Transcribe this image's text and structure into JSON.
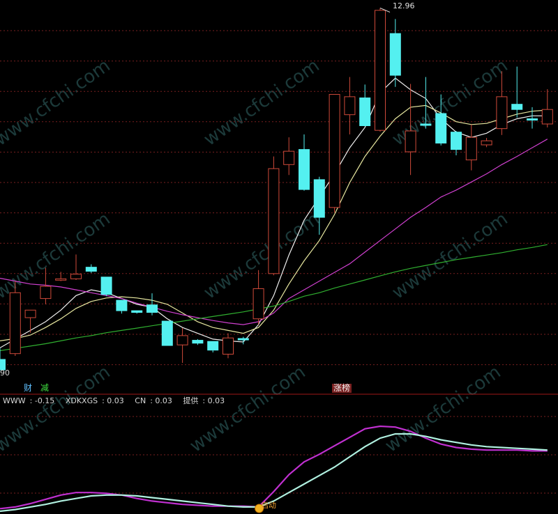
{
  "colors": {
    "background": "#000000",
    "grid": "#7a1f1f",
    "separator": "#a01818",
    "up": "#d04a3a",
    "down": "#54f0f0",
    "ma_white": "#f0f0f0",
    "ma_yellow": "#e8e8a0",
    "ma_magenta": "#d040d0",
    "ma_green": "#30b030",
    "ind_magenta": "#c030d0",
    "ind_cyan": "#b0f0e0",
    "watermark": "#1c3a3a"
  },
  "price_panel": {
    "high_label": "12.96",
    "low_label": "90",
    "tag_cai": "财",
    "tag_jian": "减",
    "tag_zhangbang": "涨榜"
  },
  "indicator_panel": {
    "readout": [
      {
        "name": "WWW",
        "value": "-0.15"
      },
      {
        "name": "XDKXGS",
        "value": "0.03"
      },
      {
        "name": "CN",
        "value": "0.03"
      },
      {
        "name": "提供",
        "value": "0.03"
      }
    ],
    "signal_label": "启动"
  },
  "watermark": "www.cfchi.com",
  "chart_data": [
    {
      "type": "candlestick",
      "ylim": [
        6.6,
        13.05
      ],
      "high_marker": 12.96,
      "candles": [
        {
          "o": 6.9,
          "h": 7.1,
          "l": 6.72,
          "c": 6.72,
          "up": false
        },
        {
          "o": 7.0,
          "h": 8.25,
          "l": 6.96,
          "c": 8.05,
          "up": true
        },
        {
          "o": 7.62,
          "h": 7.75,
          "l": 7.36,
          "c": 7.75,
          "up": true
        },
        {
          "o": 7.95,
          "h": 8.48,
          "l": 7.85,
          "c": 8.16,
          "up": true
        },
        {
          "o": 8.29,
          "h": 8.41,
          "l": 8.25,
          "c": 8.29,
          "up": true
        },
        {
          "o": 8.29,
          "h": 8.71,
          "l": 8.27,
          "c": 8.37,
          "up": true
        },
        {
          "o": 8.49,
          "h": 8.54,
          "l": 8.39,
          "c": 8.42,
          "up": false
        },
        {
          "o": 8.32,
          "h": 8.32,
          "l": 7.99,
          "c": 8.02,
          "up": false
        },
        {
          "o": 7.92,
          "h": 7.92,
          "l": 7.69,
          "c": 7.74,
          "up": false
        },
        {
          "o": 7.74,
          "h": 7.74,
          "l": 7.69,
          "c": 7.71,
          "up": false
        },
        {
          "o": 7.84,
          "h": 8.04,
          "l": 7.66,
          "c": 7.71,
          "up": false
        },
        {
          "o": 7.56,
          "h": 7.56,
          "l": 7.14,
          "c": 7.14,
          "up": false
        },
        {
          "o": 7.15,
          "h": 7.44,
          "l": 6.84,
          "c": 7.31,
          "up": true
        },
        {
          "o": 7.23,
          "h": 7.25,
          "l": 7.15,
          "c": 7.18,
          "up": false
        },
        {
          "o": 7.21,
          "h": 7.21,
          "l": 7.02,
          "c": 7.06,
          "up": false
        },
        {
          "o": 6.99,
          "h": 7.35,
          "l": 6.92,
          "c": 7.27,
          "up": true
        },
        {
          "o": 7.26,
          "h": 7.29,
          "l": 7.16,
          "c": 7.24,
          "up": false
        },
        {
          "o": 7.6,
          "h": 8.44,
          "l": 7.5,
          "c": 8.12,
          "up": true
        },
        {
          "o": 8.38,
          "h": 10.4,
          "l": 8.35,
          "c": 10.19,
          "up": true
        },
        {
          "o": 10.26,
          "h": 10.73,
          "l": 10.08,
          "c": 10.49,
          "up": true
        },
        {
          "o": 10.52,
          "h": 10.78,
          "l": 9.81,
          "c": 9.83,
          "up": false
        },
        {
          "o": 10.0,
          "h": 10.05,
          "l": 9.05,
          "c": 9.35,
          "up": false
        },
        {
          "o": 9.52,
          "h": 11.47,
          "l": 9.43,
          "c": 11.47,
          "up": true
        },
        {
          "o": 11.12,
          "h": 11.77,
          "l": 10.78,
          "c": 11.43,
          "up": true
        },
        {
          "o": 11.41,
          "h": 11.64,
          "l": 10.92,
          "c": 10.93,
          "up": false
        },
        {
          "o": 10.85,
          "h": 12.96,
          "l": 10.83,
          "c": 12.92,
          "up": true
        },
        {
          "o": 12.52,
          "h": 12.77,
          "l": 11.6,
          "c": 11.8,
          "up": false
        },
        {
          "o": 10.48,
          "h": 11.65,
          "l": 10.08,
          "c": 10.84,
          "up": true
        },
        {
          "o": 10.96,
          "h": 11.77,
          "l": 10.88,
          "c": 10.96,
          "up": false
        },
        {
          "o": 11.14,
          "h": 11.47,
          "l": 10.59,
          "c": 10.63,
          "up": false
        },
        {
          "o": 10.82,
          "h": 10.84,
          "l": 10.42,
          "c": 10.52,
          "up": false
        },
        {
          "o": 10.34,
          "h": 10.95,
          "l": 10.16,
          "c": 10.73,
          "up": true
        },
        {
          "o": 10.6,
          "h": 10.72,
          "l": 10.56,
          "c": 10.67,
          "up": true
        },
        {
          "o": 10.88,
          "h": 11.87,
          "l": 10.77,
          "c": 11.43,
          "up": true
        },
        {
          "o": 11.21,
          "h": 11.95,
          "l": 11.07,
          "c": 11.3,
          "up": false
        },
        {
          "o": 11.05,
          "h": 11.25,
          "l": 10.88,
          "c": 11.05,
          "up": false
        },
        {
          "o": 10.96,
          "h": 11.56,
          "l": 10.9,
          "c": 11.21,
          "up": true
        }
      ],
      "series": [
        {
          "color": "ma_white",
          "values": [
            7.1,
            7.25,
            7.4,
            7.55,
            7.75,
            8.0,
            8.1,
            8.05,
            7.95,
            7.85,
            7.8,
            7.6,
            7.45,
            7.35,
            7.25,
            7.22,
            7.2,
            7.5,
            8.0,
            8.7,
            9.3,
            9.7,
            10.1,
            10.55,
            10.9,
            11.5,
            11.75,
            11.55,
            11.4,
            11.05,
            10.82,
            10.73,
            10.8,
            10.95,
            11.05,
            11.1,
            11.1
          ]
        },
        {
          "color": "ma_yellow",
          "values": [
            7.22,
            7.26,
            7.32,
            7.45,
            7.6,
            7.78,
            7.9,
            7.96,
            7.98,
            7.96,
            7.92,
            7.85,
            7.7,
            7.55,
            7.45,
            7.4,
            7.35,
            7.45,
            7.75,
            8.2,
            8.6,
            8.95,
            9.4,
            9.95,
            10.4,
            10.75,
            11.05,
            11.25,
            11.28,
            11.15,
            11.0,
            10.95,
            10.97,
            11.05,
            11.13,
            11.18,
            11.2
          ]
        },
        {
          "color": "ma_magenta",
          "values": [
            8.3,
            8.25,
            8.2,
            8.18,
            8.15,
            8.1,
            8.05,
            8.0,
            7.95,
            7.87,
            7.8,
            7.73,
            7.67,
            7.62,
            7.57,
            7.53,
            7.5,
            7.55,
            7.7,
            7.95,
            8.1,
            8.25,
            8.4,
            8.55,
            8.75,
            8.95,
            9.15,
            9.35,
            9.52,
            9.7,
            9.82,
            9.96,
            10.1,
            10.26,
            10.4,
            10.55,
            10.7
          ]
        },
        {
          "color": "ma_green",
          "values": [
            7.05,
            7.09,
            7.13,
            7.17,
            7.22,
            7.27,
            7.31,
            7.36,
            7.4,
            7.44,
            7.48,
            7.52,
            7.56,
            7.6,
            7.64,
            7.68,
            7.72,
            7.77,
            7.82,
            7.9,
            7.99,
            8.05,
            8.13,
            8.2,
            8.27,
            8.34,
            8.41,
            8.47,
            8.52,
            8.57,
            8.62,
            8.66,
            8.7,
            8.74,
            8.79,
            8.83,
            8.88
          ]
        }
      ]
    },
    {
      "type": "line",
      "ylim": [
        0,
        1
      ],
      "series": [
        {
          "color": "ind_magenta",
          "values": [
            0.03,
            0.05,
            0.09,
            0.14,
            0.19,
            0.22,
            0.22,
            0.21,
            0.19,
            0.15,
            0.12,
            0.1,
            0.08,
            0.07,
            0.06,
            0.06,
            0.06,
            0.05,
            0.23,
            0.43,
            0.58,
            0.67,
            0.77,
            0.87,
            0.97,
            1.0,
            0.99,
            0.94,
            0.86,
            0.79,
            0.75,
            0.73,
            0.72,
            0.72,
            0.72,
            0.71,
            0.71
          ]
        },
        {
          "color": "ind_cyan",
          "values": [
            0.0,
            0.02,
            0.05,
            0.08,
            0.12,
            0.15,
            0.18,
            0.19,
            0.19,
            0.18,
            0.16,
            0.14,
            0.12,
            0.1,
            0.08,
            0.06,
            0.05,
            0.05,
            0.12,
            0.22,
            0.32,
            0.42,
            0.52,
            0.64,
            0.76,
            0.86,
            0.91,
            0.91,
            0.88,
            0.84,
            0.81,
            0.78,
            0.76,
            0.75,
            0.74,
            0.73,
            0.72
          ]
        }
      ]
    }
  ]
}
